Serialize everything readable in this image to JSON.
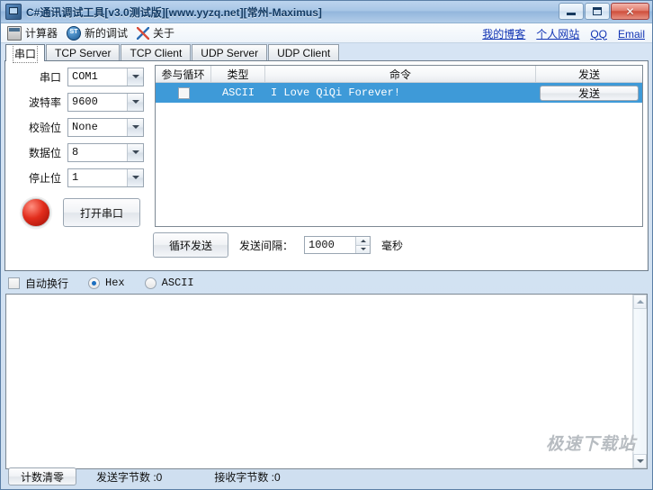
{
  "window": {
    "title": "C#通讯调试工具[v3.0测试版][www.yyzq.net][常州-Maximus]",
    "icon": "app-icon",
    "buttons": {
      "minimize": "minimize-icon",
      "maximize": "maximize-icon",
      "close": "✕"
    }
  },
  "toolbar": {
    "items": [
      {
        "label": "计算器",
        "icon": "calculator-icon"
      },
      {
        "label": "新的调试",
        "icon": "new-debug-icon"
      },
      {
        "label": "关于",
        "icon": "about-icon"
      }
    ],
    "links": [
      {
        "label": "我的博客"
      },
      {
        "label": "个人网站"
      },
      {
        "label": "QQ"
      },
      {
        "label": "Email"
      }
    ],
    "link_color": "#1134b4"
  },
  "tabs": [
    {
      "label": "串口",
      "active": true
    },
    {
      "label": "TCP Server",
      "active": false
    },
    {
      "label": "TCP Client",
      "active": false
    },
    {
      "label": "UDP Server",
      "active": false
    },
    {
      "label": "UDP Client",
      "active": false
    }
  ],
  "serial_form": {
    "fields": [
      {
        "label": "串口",
        "value": "COM1"
      },
      {
        "label": "波特率",
        "value": "9600"
      },
      {
        "label": "校验位",
        "value": "None"
      },
      {
        "label": "数据位",
        "value": "8"
      },
      {
        "label": "停止位",
        "value": "1"
      }
    ],
    "led": {
      "name": "status-led",
      "color": "#e22d1c",
      "state": "closed"
    },
    "open_button": "打开串口"
  },
  "command_list": {
    "columns": [
      "参与循环",
      "类型",
      "命令",
      "发送"
    ],
    "rows": [
      {
        "checked": false,
        "type": "ASCII",
        "command": "I Love QiQi Forever!",
        "send_label": "发送",
        "selected": true
      }
    ],
    "selection_color": "#3e9ad8"
  },
  "loop_controls": {
    "loop_send_label": "循环发送",
    "interval_label": "发送间隔：",
    "interval_value": "1000",
    "unit": "毫秒"
  },
  "options": {
    "autowrap_label": "自动换行",
    "autowrap_checked": false,
    "hex_label": "Hex",
    "hex_checked": true,
    "ascii_label": "ASCII",
    "ascii_checked": false
  },
  "log": {
    "content": ""
  },
  "statusbar": {
    "clear_button": "计数清零",
    "sent_label": "发送字节数 :0",
    "recv_label": "接收字节数 :0"
  },
  "watermark": "极速下载站"
}
